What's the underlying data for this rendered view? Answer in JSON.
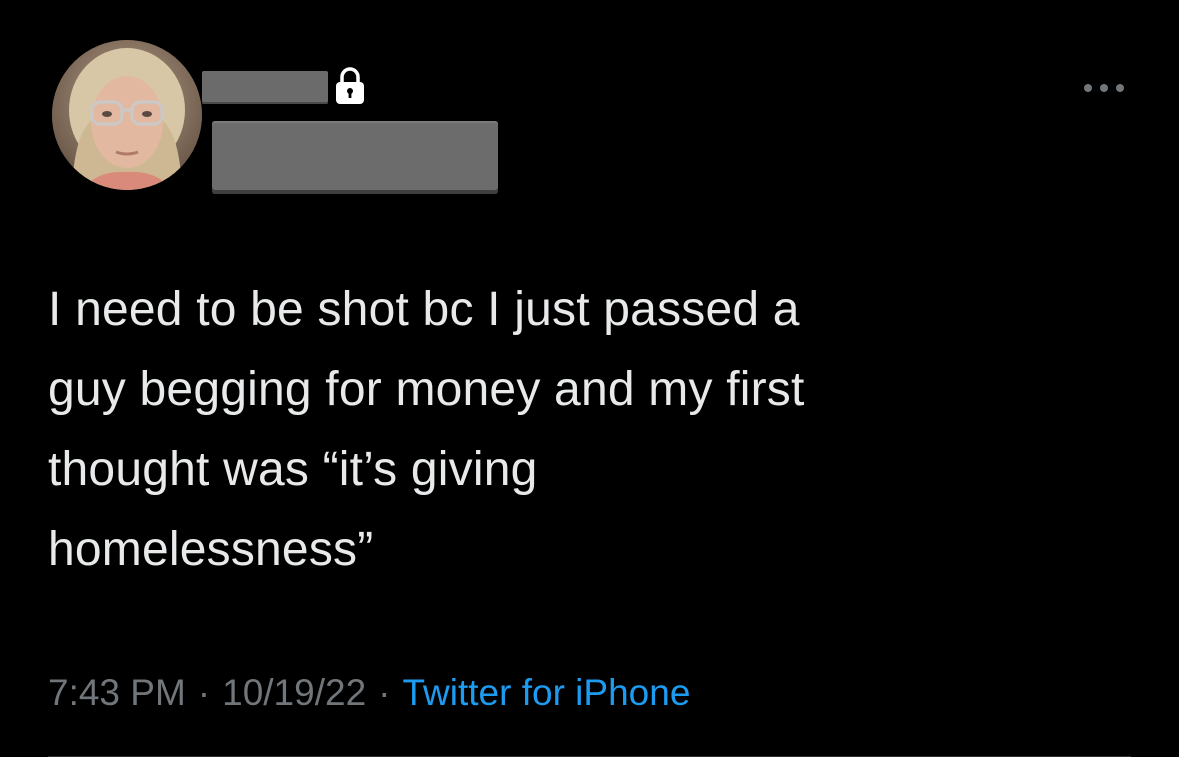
{
  "tweet": {
    "text": "I need to be shot bc I just passed a\nguy begging for money and my first\nthought was “it’s giving\nhomelessness”",
    "time": "7:43 PM",
    "separator": "·",
    "date": "10/19/22",
    "source": "Twitter for iPhone"
  },
  "icons": {
    "lock": "lock-icon",
    "more": "more-horizontal-icon"
  },
  "colors": {
    "background": "#000000",
    "text": "#e7e9ea",
    "meta": "#71767b",
    "link": "#1d9bf0",
    "redaction": "#6b6b6b"
  }
}
